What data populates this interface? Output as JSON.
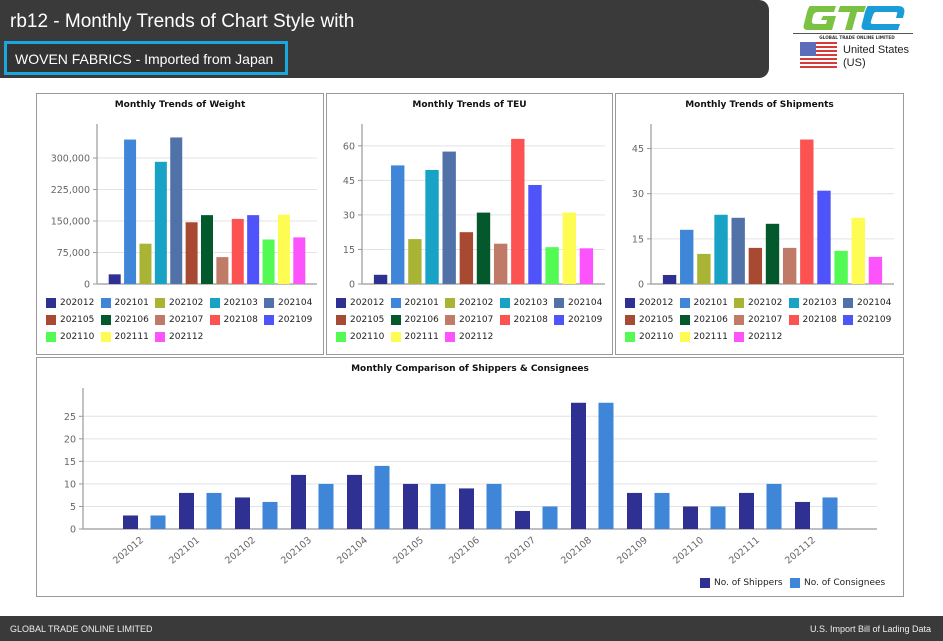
{
  "header": {
    "title": "rb12 - Monthly Trends of Chart Style with",
    "subtitle": "WOVEN FABRICS - Imported from Japan",
    "logo_name": "GTC",
    "logo_tagline": "GLOBAL TRADE ONLINE LIMITED",
    "country_line1": "United States",
    "country_line2": "(US)"
  },
  "footer": {
    "left": "GLOBAL TRADE ONLINE LIMITED",
    "right": "U.S. Import Bill of Lading Data"
  },
  "colors": {
    "header_bg": "#3a3a3a",
    "subtitle_border": "#1aa7de",
    "month_palette": [
      "#2f3192",
      "#3f86d8",
      "#aab434",
      "#18a2c6",
      "#5072a8",
      "#a84a32",
      "#03582c",
      "#c07a68",
      "#fd5252",
      "#4f53fa",
      "#53fa53",
      "#fefc53",
      "#fc53fc"
    ],
    "shippers": "#2f3192",
    "consignees": "#3f86d8"
  },
  "chart_data": [
    {
      "type": "bar",
      "title": "Monthly Trends of Weight",
      "categories": [
        "202012",
        "202101",
        "202102",
        "202103",
        "202104",
        "202105",
        "202106",
        "202107",
        "202108",
        "202109",
        "202110",
        "202111",
        "202112"
      ],
      "values": [
        23000,
        344000,
        96000,
        291000,
        349000,
        147000,
        164000,
        64000,
        155000,
        164000,
        106000,
        165000,
        111000
      ],
      "yticks": [
        0,
        75000,
        150000,
        225000,
        300000
      ],
      "ytick_labels": [
        "0",
        "75,000",
        "150,000",
        "225,000",
        "300,000"
      ],
      "ylim": [
        0,
        362000
      ],
      "xlabel": "",
      "ylabel": "",
      "grid": true,
      "legend": "bottom"
    },
    {
      "type": "bar",
      "title": "Monthly Trends of TEU",
      "categories": [
        "202012",
        "202101",
        "202102",
        "202103",
        "202104",
        "202105",
        "202106",
        "202107",
        "202108",
        "202109",
        "202110",
        "202111",
        "202112"
      ],
      "values": [
        4,
        51.5,
        19.5,
        49.5,
        57.5,
        22.5,
        31,
        17.5,
        63,
        43,
        16,
        31,
        15.5
      ],
      "yticks": [
        0,
        15,
        30,
        45,
        60
      ],
      "ytick_labels": [
        "0",
        "15",
        "30",
        "45",
        "60"
      ],
      "ylim": [
        0,
        66
      ],
      "xlabel": "",
      "ylabel": "",
      "grid": true,
      "legend": "bottom"
    },
    {
      "type": "bar",
      "title": "Monthly Trends of Shipments",
      "categories": [
        "202012",
        "202101",
        "202102",
        "202103",
        "202104",
        "202105",
        "202106",
        "202107",
        "202108",
        "202109",
        "202110",
        "202111",
        "202112"
      ],
      "values": [
        3,
        18,
        10,
        23,
        22,
        12,
        20,
        12,
        48,
        31,
        11,
        22,
        9
      ],
      "yticks": [
        0,
        15,
        30,
        45
      ],
      "ytick_labels": [
        "0",
        "15",
        "30",
        "45"
      ],
      "ylim": [
        0,
        50.5
      ],
      "xlabel": "",
      "ylabel": "",
      "grid": true,
      "legend": "bottom"
    },
    {
      "type": "bar",
      "title": "Monthly Comparison of Shippers & Consignees",
      "categories": [
        "202012",
        "202101",
        "202102",
        "202103",
        "202104",
        "202105",
        "202106",
        "202107",
        "202108",
        "202109",
        "202110",
        "202111",
        "202112"
      ],
      "series": [
        {
          "name": "No. of Shippers",
          "values": [
            3,
            8,
            7,
            12,
            12,
            10,
            9,
            4,
            28,
            8,
            5,
            8,
            6
          ]
        },
        {
          "name": "No. of Consignees",
          "values": [
            3,
            8,
            6,
            10,
            14,
            10,
            10,
            5,
            28,
            8,
            5,
            10,
            7
          ]
        }
      ],
      "yticks": [
        0,
        5,
        10,
        15,
        20,
        25
      ],
      "ytick_labels": [
        "0",
        "5",
        "10",
        "15",
        "20",
        "25"
      ],
      "ylim": [
        0,
        29.5
      ],
      "xlabel": "",
      "ylabel": "",
      "grid": true,
      "legend": "bottom-right"
    }
  ]
}
